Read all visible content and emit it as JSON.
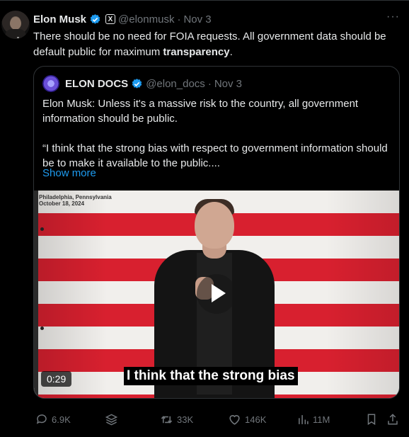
{
  "tweet": {
    "author_name": "Elon Musk",
    "x_badge": "X",
    "handle": "@elonmusk",
    "separator": "·",
    "date": "Nov 3",
    "more": "···",
    "text_before": "There should be no need for FOIA requests. All government data should be default public for maximum ",
    "text_bold": "transparency",
    "text_after": "."
  },
  "quote": {
    "author_name": "ELON DOCS",
    "handle": "@elon_docs",
    "separator": "·",
    "date": "Nov 3",
    "paragraph1": "Elon Musk: Unless it's a massive risk to the country, all government information should be public.",
    "paragraph2": "“I think that the strong bias with respect to government information should be to make it available to the public....",
    "show_more": "Show more"
  },
  "video": {
    "location_line1": "Philadelphia, Pennsylvania",
    "location_line2": "October 18, 2024",
    "duration": "0:29",
    "caption": "I think that the strong bias"
  },
  "actions": {
    "replies": "6.9K",
    "reposts": "33K",
    "likes": "146K",
    "views": "11M"
  },
  "icons": {
    "verified": "verified-badge-icon",
    "reply": "reply-icon",
    "grok": "grok-icon",
    "repost": "repost-icon",
    "like": "heart-icon",
    "views": "views-icon",
    "bookmark": "bookmark-icon",
    "share": "share-icon"
  },
  "colors": {
    "background": "#000000",
    "text": "#e7e9ea",
    "muted": "#71767b",
    "accent": "#1d9bf0",
    "border": "#2f3336"
  }
}
